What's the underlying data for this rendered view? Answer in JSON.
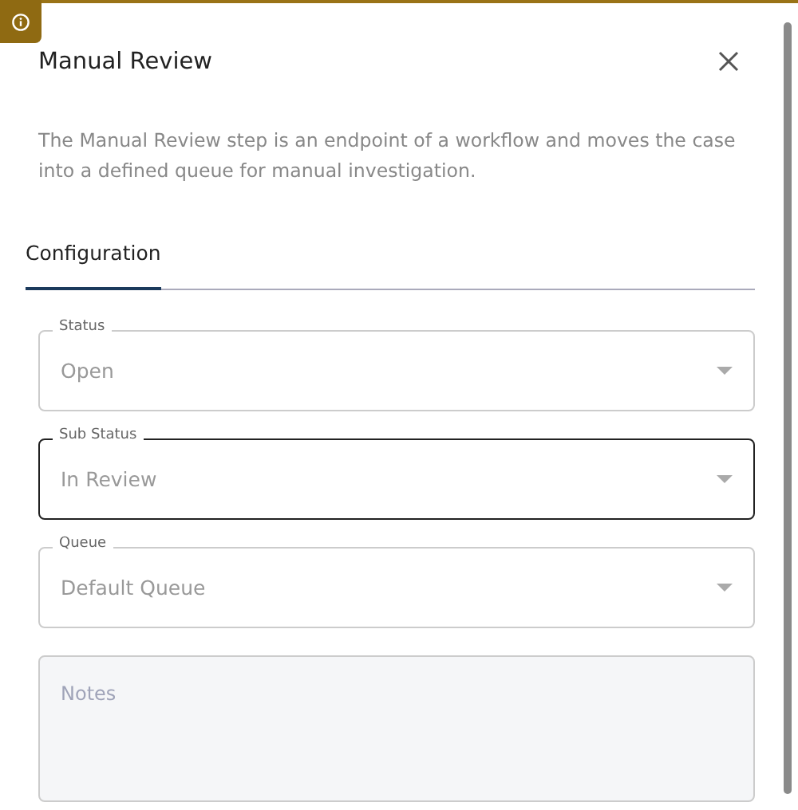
{
  "title": "Manual Review",
  "description": "The Manual Review step is an endpoint of a workflow and moves the case into a defined queue for manual investigation.",
  "tabs": [
    {
      "label": "Configuration",
      "selected": true
    }
  ],
  "fields": [
    {
      "kind": "select",
      "label": "Status",
      "value": "Open",
      "focused": false
    },
    {
      "kind": "select",
      "label": "Sub Status",
      "value": "In Review",
      "focused": true
    },
    {
      "kind": "select",
      "label": "Queue",
      "value": "Default Queue",
      "focused": false
    },
    {
      "kind": "textarea",
      "placeholder": "Notes"
    }
  ]
}
